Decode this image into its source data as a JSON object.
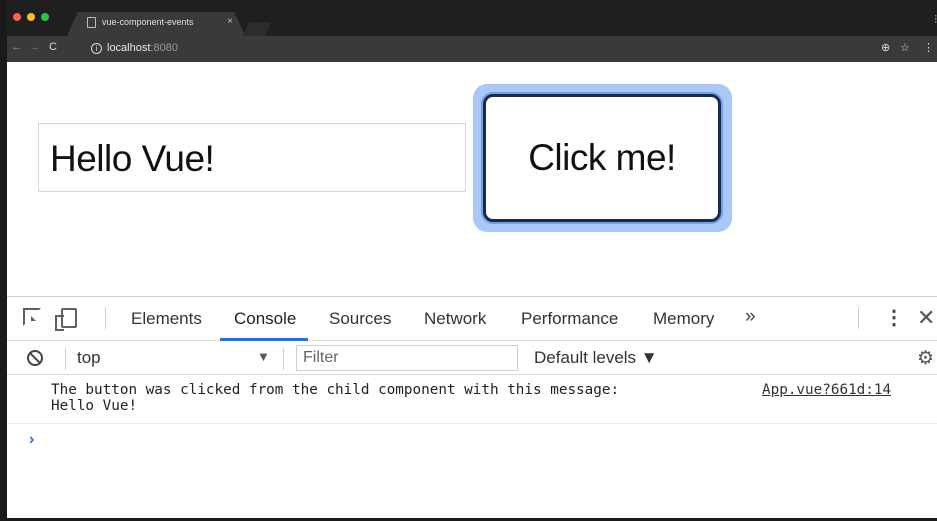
{
  "browser": {
    "traffic_lights": [
      "#ff5f57",
      "#febc2e",
      "#28c840"
    ],
    "tab": {
      "title": "vue-component-events",
      "close": "×"
    },
    "address": {
      "host": "localhost",
      "port": ":8080"
    },
    "nav": {
      "back": "←",
      "forward": "→",
      "reload": "C"
    },
    "right_icons": {
      "zoom": "⊕",
      "star": "☆",
      "menu": "⋮"
    },
    "corner_icon": "⫶"
  },
  "page": {
    "message": "Hello Vue!",
    "button_label": "Click me!"
  },
  "devtools": {
    "tabs": [
      {
        "label": "Elements",
        "active": false
      },
      {
        "label": "Console",
        "active": true
      },
      {
        "label": "Sources",
        "active": false
      },
      {
        "label": "Network",
        "active": false
      },
      {
        "label": "Performance",
        "active": false
      },
      {
        "label": "Memory",
        "active": false
      }
    ],
    "more": "»",
    "kebab": "⋮",
    "close": "✕",
    "context": "top",
    "context_arrow": "▼",
    "filter_placeholder": "Filter",
    "levels": "Default levels ▼",
    "gear": "⚙",
    "log": {
      "message": "The button was clicked from the child component with this message:\nHello Vue!",
      "source": "App.vue?661d:14"
    },
    "prompt": "›",
    "accent": "#1a73e8"
  }
}
